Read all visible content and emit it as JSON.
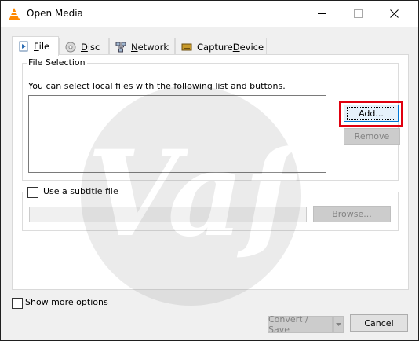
{
  "window": {
    "title": "Open Media",
    "icon": "vlc-cone-icon"
  },
  "tabs": [
    {
      "label_pre": "",
      "label_u": "F",
      "label_post": "ile",
      "icon": "file-icon",
      "active": true
    },
    {
      "label_pre": "",
      "label_u": "D",
      "label_post": "isc",
      "icon": "disc-icon",
      "active": false
    },
    {
      "label_pre": "",
      "label_u": "N",
      "label_post": "etwork",
      "icon": "network-icon",
      "active": false
    },
    {
      "label_pre": "Capture ",
      "label_u": "D",
      "label_post": "evice",
      "icon": "capture-device-icon",
      "active": false
    }
  ],
  "file_selection": {
    "title": "File Selection",
    "help_text": "You can select local files with the following list and buttons.",
    "add_label": "Add...",
    "remove_label": "Remove"
  },
  "subtitle": {
    "checkbox_label": "Use a subtitle file",
    "browse_label": "Browse..."
  },
  "footer": {
    "show_more_label": "Show more options",
    "convert_label": "Convert / Save",
    "cancel_label": "Cancel"
  },
  "colors": {
    "highlight": "#e0000f",
    "accent": "#0078d7"
  }
}
